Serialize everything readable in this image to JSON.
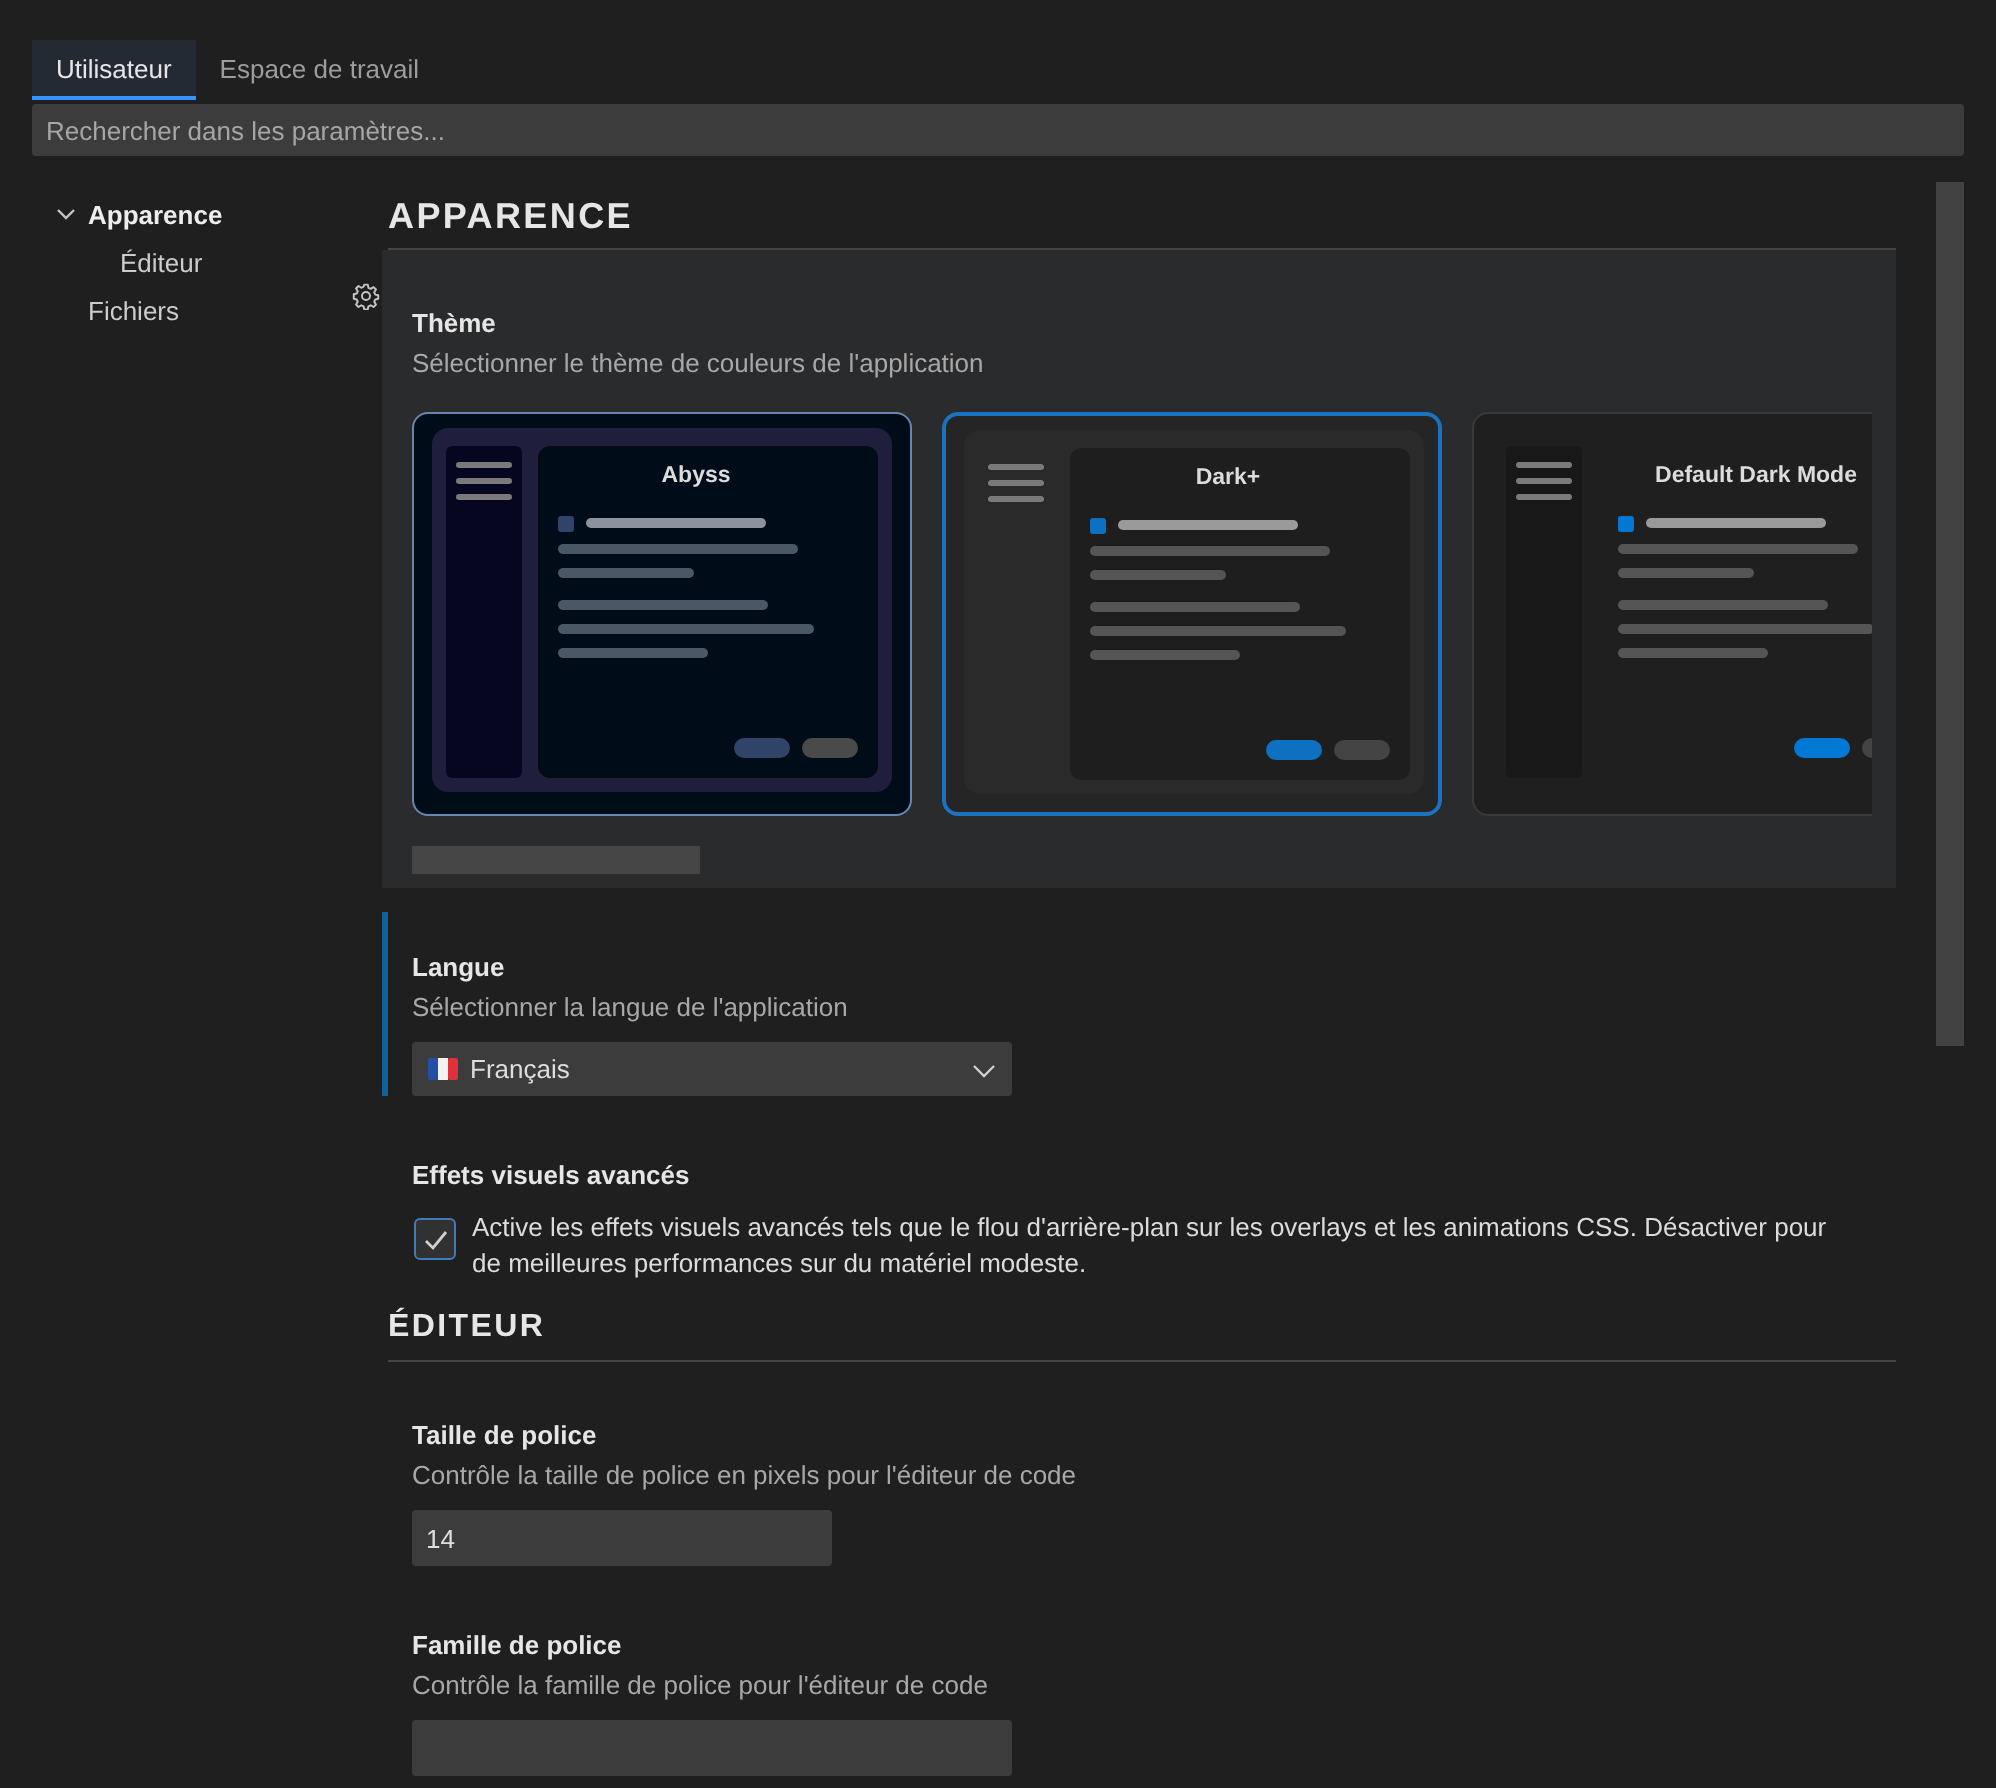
{
  "tabs": [
    {
      "label": "Utilisateur",
      "selected": true
    },
    {
      "label": "Espace de travail",
      "selected": false
    }
  ],
  "search": {
    "placeholder": "Rechercher dans les paramètres..."
  },
  "sidebar": {
    "items": [
      {
        "label": "Apparence",
        "selected": true,
        "expanded": true,
        "children": [
          {
            "label": "Éditeur",
            "selected": false
          }
        ]
      },
      {
        "label": "Fichiers",
        "selected": false
      }
    ]
  },
  "sections": [
    {
      "title": "APPARENCE",
      "settings": [
        {
          "kind": "theme",
          "title": "Thème",
          "description": "Sélectionner le thème de couleurs de l'application",
          "hovered": true,
          "focused": false,
          "themes": [
            {
              "name": "Abyss",
              "kind": "abyss",
              "selected": false
            },
            {
              "name": "Dark+",
              "kind": "dark-plus",
              "selected": true
            },
            {
              "name": "Default Dark Mode",
              "kind": "default-dark",
              "selected": false
            }
          ]
        },
        {
          "kind": "select",
          "title": "Langue",
          "description": "Sélectionner la langue de l'application",
          "hovered": false,
          "focused": true,
          "value": "Français"
        },
        {
          "kind": "checkbox",
          "title": "Effets visuels avancés",
          "description": "Active les effets visuels avancés tels que le flou d'arrière-plan sur les overlays et les animations CSS. Désactiver pour de meilleures performances sur du matériel modeste.",
          "hovered": false,
          "focused": false,
          "checked": true
        }
      ]
    },
    {
      "title": "ÉDITEUR",
      "settings": [
        {
          "kind": "number",
          "title": "Taille de police",
          "description": "Contrôle la taille de police en pixels pour l'éditeur de code",
          "hovered": false,
          "focused": false,
          "value": "14"
        },
        {
          "kind": "text",
          "title": "Famille de police",
          "description": "Contrôle la famille de police pour l'éditeur de code",
          "hovered": false,
          "focused": false
        }
      ]
    }
  ]
}
